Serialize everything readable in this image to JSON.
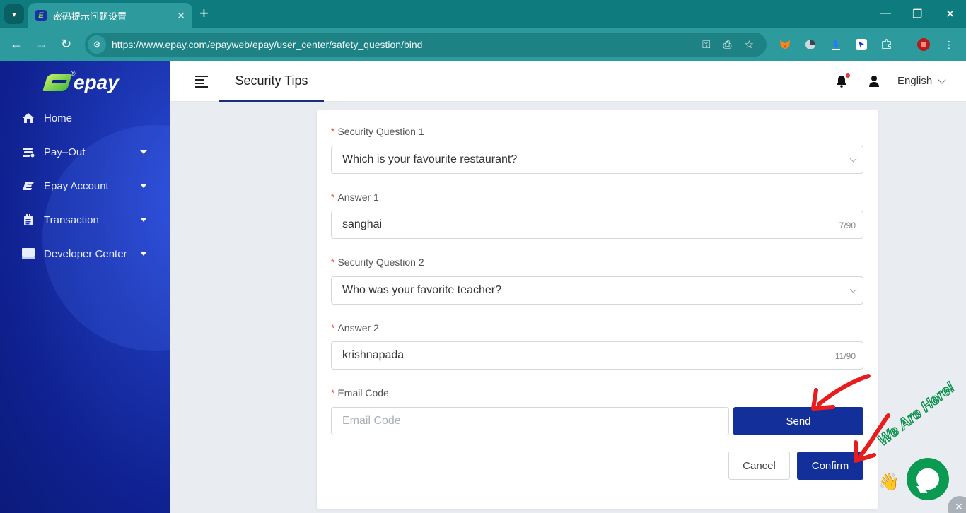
{
  "browser": {
    "tab_title": "密码提示问题设置",
    "tab_close": "✕",
    "new_tab": "+",
    "url": "https://www.epay.com/epayweb/epay/user_center/safety_question/bind",
    "window_controls": {
      "minimize": "—",
      "restore": "❐",
      "close": "✕"
    }
  },
  "sidebar": {
    "logo_text": "epay",
    "logo_reg": "®",
    "items": [
      {
        "label": "Home",
        "icon": "home-icon",
        "has_caret": false
      },
      {
        "label": "Pay–Out",
        "icon": "payout-icon",
        "has_caret": true
      },
      {
        "label": "Epay Account",
        "icon": "epay-account-icon",
        "has_caret": true
      },
      {
        "label": "Transaction",
        "icon": "transaction-icon",
        "has_caret": true
      },
      {
        "label": "Developer Center",
        "icon": "monitor-icon",
        "has_caret": true
      }
    ]
  },
  "header": {
    "page_tab": "Security Tips",
    "language": "English"
  },
  "form": {
    "q1": {
      "label": "Security Question 1",
      "value": "Which is your favourite restaurant?"
    },
    "a1": {
      "label": "Answer 1",
      "value": "sanghai",
      "counter": "7/90"
    },
    "q2": {
      "label": "Security Question 2",
      "value": "Who was your favorite teacher?"
    },
    "a2": {
      "label": "Answer 2",
      "value": "krishnapada",
      "counter": "11/90"
    },
    "email": {
      "label": "Email Code",
      "placeholder": "Email Code"
    },
    "required_mark": "*",
    "send_label": "Send",
    "cancel_label": "Cancel",
    "confirm_label": "Confirm"
  },
  "chat_widget": {
    "tagline": "We Are Here!",
    "close": "✕"
  },
  "colors": {
    "browser_dark": "#0e7b7e",
    "browser_light": "#2d9b9e",
    "sidebar": "#1b34b0",
    "primary_button": "#13309a",
    "required": "#f04848",
    "annotation_arrow": "#e81c1c",
    "chat_green": "#0a9a52"
  }
}
